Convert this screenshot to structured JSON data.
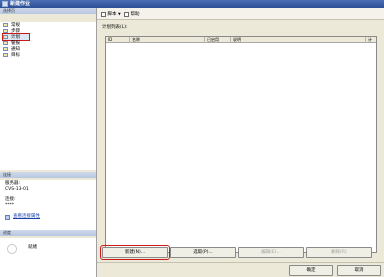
{
  "window": {
    "title": "新建作业"
  },
  "left_pane": {
    "header": "选择页",
    "pages": [
      {
        "label": "常规",
        "selected": false
      },
      {
        "label": "步骤",
        "selected": false
      },
      {
        "label": "计划",
        "selected": true
      },
      {
        "label": "警报",
        "selected": false
      },
      {
        "label": "通知",
        "selected": false
      },
      {
        "label": "目标",
        "selected": false
      }
    ],
    "connection": {
      "header": "连接",
      "server_label": "服务器:",
      "server_value": "CVS-13-01",
      "conn_label": "连接:",
      "conn_value": "****",
      "view_link": "查看连接属性"
    },
    "progress": {
      "header": "进度",
      "status": "就绪"
    }
  },
  "toolbar": {
    "script": "脚本",
    "help": "帮助"
  },
  "main": {
    "list_label": "计划列表(L):",
    "columns": [
      "ID",
      "名称",
      "已启用",
      "说明",
      "计"
    ]
  },
  "buttons": {
    "new": "新建(N)...",
    "pick": "选取(P)...",
    "edit": "编辑(E)...",
    "remove": "删除(R)"
  },
  "footer": {
    "ok": "确定",
    "cancel": "取消"
  }
}
